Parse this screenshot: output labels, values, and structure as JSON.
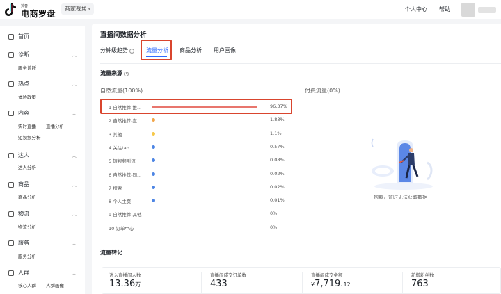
{
  "header": {
    "logo_small": "抖音",
    "logo_name": "电商罗盘",
    "view_switch": "商家视角",
    "personal_center": "个人中心",
    "help": "帮助"
  },
  "sidebar": {
    "home": "首页",
    "sections": [
      {
        "label": "诊断",
        "icon": "diagnosis-icon",
        "subs": [
          "服务诊断"
        ]
      },
      {
        "label": "热点",
        "icon": "hot-icon",
        "subs": [
          "体验政策"
        ]
      },
      {
        "label": "内容",
        "icon": "content-icon",
        "subs": [
          "实时直播",
          "直播分析",
          "短视频分析"
        ]
      },
      {
        "label": "达人",
        "icon": "creator-icon",
        "subs": [
          "达人分析"
        ]
      },
      {
        "label": "商品",
        "icon": "product-icon",
        "subs": [
          "商品分析"
        ]
      },
      {
        "label": "物流",
        "icon": "logistics-icon",
        "subs": [
          "物流分析"
        ]
      },
      {
        "label": "服务",
        "icon": "service-icon",
        "subs": [
          "服务分析"
        ]
      },
      {
        "label": "人群",
        "icon": "audience-icon",
        "subs": [
          "核心人群",
          "人群画像"
        ]
      }
    ]
  },
  "main": {
    "title": "直播间数据分析",
    "tabs": [
      {
        "label": "分钟级趋势",
        "active": false
      },
      {
        "label": "流量分析",
        "active": true
      },
      {
        "label": "商品分析",
        "active": false
      },
      {
        "label": "用户画像",
        "active": false
      }
    ],
    "traffic_source_title": "流量来源",
    "natural_traffic_label": "自然流量(100%)",
    "paid_traffic_label": "付费流量(0%)",
    "sources": [
      {
        "label": "1 自然推荐-推...",
        "pct": "96.37%",
        "value": 96.37,
        "color": "#e8766d"
      },
      {
        "label": "2 自然推荐-直...",
        "pct": "1.83%",
        "value": 1.83,
        "color": "#f2a64a"
      },
      {
        "label": "3 其他",
        "pct": "1.1%",
        "value": 1.1,
        "color": "#f6c84a"
      },
      {
        "label": "4 关注tab",
        "pct": "0.57%",
        "value": 0.57,
        "color": "#4e86e4"
      },
      {
        "label": "5 短视频引流",
        "pct": "0.08%",
        "value": 0.08,
        "color": "#4e86e4"
      },
      {
        "label": "6 自然推荐-同...",
        "pct": "0.02%",
        "value": 0.02,
        "color": "#4e86e4"
      },
      {
        "label": "7 搜索",
        "pct": "0.02%",
        "value": 0.02,
        "color": "#4e86e4"
      },
      {
        "label": "8 个人主页",
        "pct": "0.01%",
        "value": 0.01,
        "color": "#4e86e4"
      },
      {
        "label": "9 自然推荐-其他",
        "pct": "0%",
        "value": 0,
        "color": "#4e86e4"
      },
      {
        "label": "10 订单中心",
        "pct": "0%",
        "value": 0,
        "color": "#4e86e4"
      }
    ],
    "empty_state_text": "抱歉，暂时无法获取数据",
    "conversion_title": "流量转化",
    "metrics": [
      {
        "label": "进入直播间人数",
        "value": "13.36",
        "unit": "万"
      },
      {
        "label": "直播间成交订单数",
        "value": "433",
        "unit": ""
      },
      {
        "label": "直播间成交金额",
        "prefix": "¥",
        "value": "7,719.",
        "unit": "12"
      },
      {
        "label": "新增粉丝数",
        "value": "763",
        "unit": ""
      }
    ]
  }
}
